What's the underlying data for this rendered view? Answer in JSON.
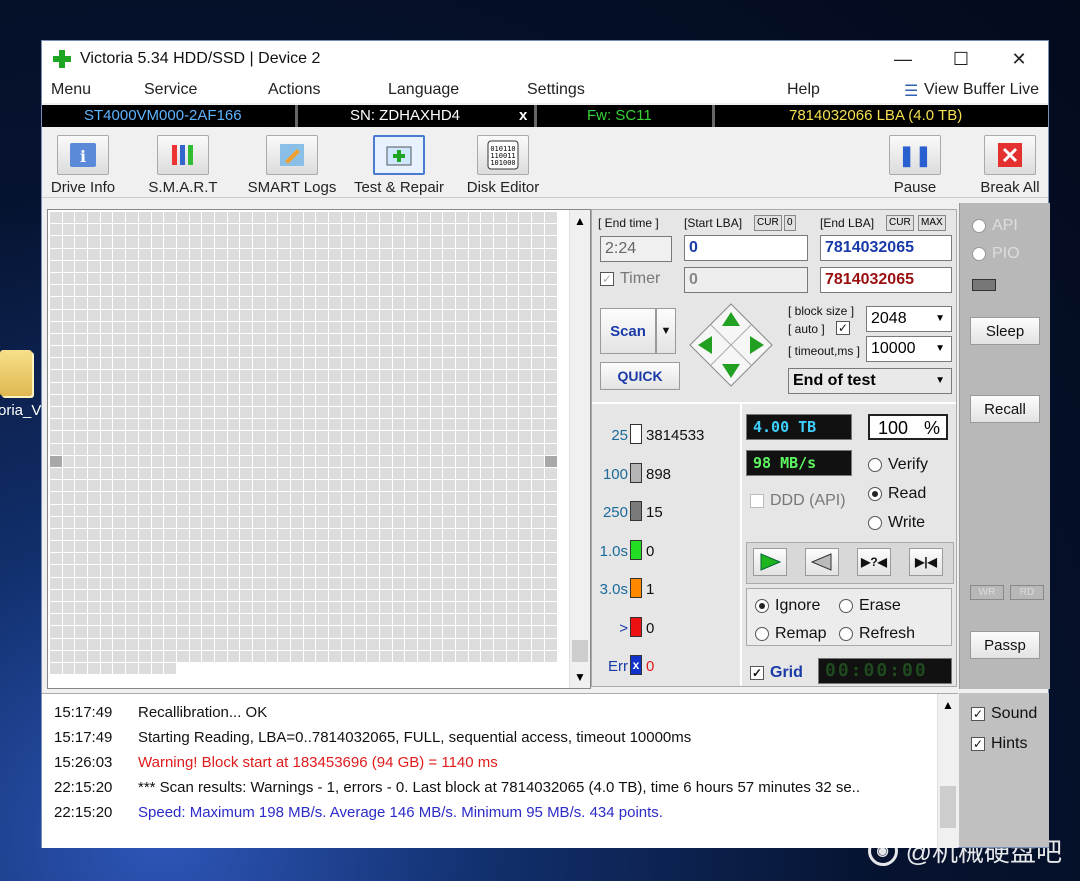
{
  "window": {
    "title": "Victoria 5.34 HDD/SSD | Device 2",
    "minimize": "—",
    "maximize": "☐",
    "close": "✕"
  },
  "desktop": {
    "icon_label": "oria_V"
  },
  "watermark": "@机械硬盘吧",
  "menu": [
    "Menu",
    "Service",
    "Actions",
    "Language",
    "Settings",
    "Help"
  ],
  "view_buffer": "View Buffer Live",
  "info": {
    "model": "ST4000VM000-2AF166",
    "serial": "SN: ZDHAXHD4",
    "x": "x",
    "fw": "Fw: SC11",
    "lba": "7814032066 LBA (4.0 TB)"
  },
  "toolbar": [
    "Drive Info",
    "S.M.A.R.T",
    "SMART Logs",
    "Test & Repair",
    "Disk Editor"
  ],
  "pause": "Pause",
  "break_all": "Break All",
  "scan": {
    "end_time_label": "[ End time ]",
    "end_time_value": "2:24",
    "start_lba_label": "[Start LBA]",
    "cur": "CUR",
    "zero": "0",
    "start_lba": "0",
    "start_lba_cur": "0",
    "end_lba_label": "[End LBA]",
    "max": "MAX",
    "end_lba": "7814032065",
    "end_lba_cur": "7814032065",
    "timer": "Timer",
    "scan_btn": "Scan",
    "quick_btn": "QUICK",
    "block_size_label": "[ block size ]",
    "auto_label": "[ auto ]",
    "timeout_label": "[ timeout,ms ]",
    "block_size": "2048",
    "timeout": "10000",
    "end_action": "End of test"
  },
  "legend": [
    {
      "key": "25",
      "value": "3814533",
      "color": "#ffffff"
    },
    {
      "key": "100",
      "value": "898",
      "color": "#b4b4b4"
    },
    {
      "key": "250",
      "value": "15",
      "color": "#7a7a7a"
    },
    {
      "key": "1.0s",
      "value": "0",
      "color": "#22dd22"
    },
    {
      "key": "3.0s",
      "value": "1",
      "color": "#ff8800"
    },
    {
      "key": ">",
      "value": "0",
      "color": "#ee1111"
    },
    {
      "key": "Err",
      "value": "0",
      "color": "#1133cc"
    }
  ],
  "err_icon": "x",
  "status": {
    "size": "4.00 TB",
    "percent": "100",
    "percent_sign": "%",
    "speed": "98 MB/s",
    "ddd": "DDD (API)",
    "timer_display": "00:00:00"
  },
  "modes": [
    "Verify",
    "Read",
    "Write"
  ],
  "repair": [
    "Ignore",
    "Erase",
    "Remap",
    "Refresh"
  ],
  "grid_label": "Grid",
  "right_panel": {
    "api": "API",
    "pio": "PIO",
    "sleep": "Sleep",
    "recall": "Recall",
    "wr": "WR",
    "rd": "RD",
    "passp": "Passp"
  },
  "options": [
    "Sound",
    "Hints"
  ],
  "log": [
    {
      "time": "15:17:49",
      "text": "Recallibration... OK",
      "color": "#111111"
    },
    {
      "time": "15:17:49",
      "text": "Starting Reading, LBA=0..7814032065, FULL, sequential access, timeout 10000ms",
      "color": "#111111"
    },
    {
      "time": "15:26:03",
      "text": "Warning! Block start at 183453696 (94 GB)  = 1140 ms",
      "color": "#e01b1b"
    },
    {
      "time": "22:15:20",
      "text": "*** Scan results: Warnings - 1, errors - 0. Last block at 7814032065 (4.0 TB), time 6 hours 57 minutes 32 se..",
      "color": "#111111"
    },
    {
      "time": "22:15:20",
      "text": "Speed: Maximum 198 MB/s. Average 146 MB/s. Minimum 95 MB/s. 434 points.",
      "color": "#2b2bc8"
    }
  ]
}
